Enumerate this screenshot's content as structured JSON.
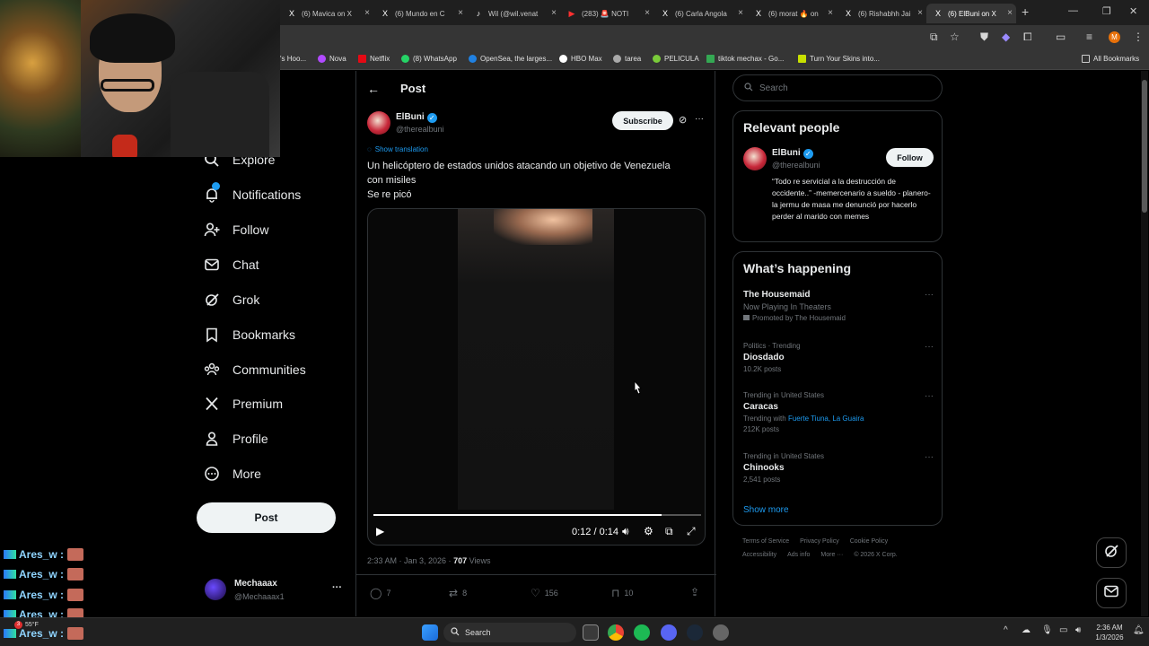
{
  "browser": {
    "tabs": [
      {
        "label": "(6) Mavica on X",
        "icon": "X"
      },
      {
        "label": "(6) Mundo en C",
        "icon": "X"
      },
      {
        "label": "Wil (@wil.venat",
        "icon": "♪"
      },
      {
        "label": "(283) 🚨 NOTI",
        "icon": "▶"
      },
      {
        "label": "(6) Carla Angola",
        "icon": "X"
      },
      {
        "label": "(6) morat 🔥 on",
        "icon": "X"
      },
      {
        "label": "(6) Rishabhh Jai",
        "icon": "X"
      },
      {
        "label": "(6) ElBuni on X",
        "icon": "X"
      }
    ],
    "new_tab": "+",
    "profile_initial": "M",
    "bookmarks": [
      {
        "label": "'s Hoo...",
        "color": "#888888"
      },
      {
        "label": "Nova",
        "color": "#b14aff"
      },
      {
        "label": "Netflix",
        "color": "#e50914"
      },
      {
        "label": "(8) WhatsApp",
        "color": "#25d366"
      },
      {
        "label": "OpenSea, the larges...",
        "color": "#2081e2"
      },
      {
        "label": "HBO Max",
        "color": "#ffffff"
      },
      {
        "label": "tarea",
        "color": "#aaaaaa"
      },
      {
        "label": "PELICULA",
        "color": "#7acb3a"
      },
      {
        "label": "tiktok mechax - Go...",
        "color": "#34a853"
      },
      {
        "label": "Turn Your Skins into...",
        "color": "#c8e000"
      }
    ],
    "all_bookmarks": "All Bookmarks"
  },
  "nav": {
    "items": [
      {
        "label": "Explore",
        "name": "explore"
      },
      {
        "label": "Notifications",
        "name": "notifications"
      },
      {
        "label": "Follow",
        "name": "follow"
      },
      {
        "label": "Chat",
        "name": "chat"
      },
      {
        "label": "Grok",
        "name": "grok"
      },
      {
        "label": "Bookmarks",
        "name": "bookmarks"
      },
      {
        "label": "Communities",
        "name": "communities"
      },
      {
        "label": "Premium",
        "name": "premium"
      },
      {
        "label": "Profile",
        "name": "profile"
      },
      {
        "label": "More",
        "name": "more"
      }
    ],
    "post_button": "Post",
    "account": {
      "name": "Mechaaax",
      "handle": "@Mechaaax1",
      "menu": "···"
    }
  },
  "post": {
    "header_title": "Post",
    "author_name": "ElBuni",
    "author_handle": "@therealbuni",
    "subscribe": "Subscribe",
    "more": "···",
    "show_translation": "Show translation",
    "text_line1": "Un helicóptero de estados unidos atacando un objetivo de Venezuela",
    "text_line2": "con misiles",
    "text_line3": "Se re picó",
    "video": {
      "time": "0:12 / 0:14",
      "progress": 0.88
    },
    "timestamp": "2:33 AM · Jan 3, 2026 · ",
    "views_count": "707",
    "views_label": " Views",
    "stats": {
      "replies": "7",
      "reposts": "8",
      "likes": "156",
      "bookmarks": "10"
    }
  },
  "sidebar": {
    "search_placeholder": "Search",
    "relevant": {
      "title": "Relevant people",
      "name": "ElBuni",
      "handle": "@therealbuni",
      "follow": "Follow",
      "bio": "“Todo re servicial a la destrucción de occidente..” -memercenario a sueldo - planero- la jermu de masa me denunció por hacerlo perder al marido con memes"
    },
    "happening": {
      "title": "What’s happening",
      "trends": [
        {
          "meta": "",
          "name": "The Housemaid",
          "sub": "Now Playing In Theaters",
          "extra": "Promoted by The Housemaid"
        },
        {
          "meta": "Politics · Trending",
          "name": "Diosdado",
          "sub": "10.2K posts",
          "extra": ""
        },
        {
          "meta": "Trending in United States",
          "name": "Caracas",
          "sub_prefix": "Trending with ",
          "sub_link": "Fuerte Tiuna, La Guaira",
          "sub": "212K posts",
          "extra": ""
        },
        {
          "meta": "Trending in United States",
          "name": "Chinooks",
          "sub": "2,541 posts",
          "extra": ""
        }
      ],
      "show_more": "Show more"
    },
    "footer_line1": [
      "Terms of Service",
      "Privacy Policy",
      "Cookie Policy"
    ],
    "footer_line2": [
      "Accessibility",
      "Ads info",
      "More ···",
      "© 2026 X Corp."
    ]
  },
  "chat_overlay": {
    "user": "Ares_w :",
    "lines": 5
  },
  "taskbar": {
    "search": "Search",
    "weather": "55°F",
    "badge": "3",
    "time": "2:36 AM",
    "date": "1/3/2026"
  },
  "colors": {
    "accent": "#1d9bf0",
    "bg": "#000000",
    "border": "#2f3336",
    "muted": "#71767b"
  }
}
